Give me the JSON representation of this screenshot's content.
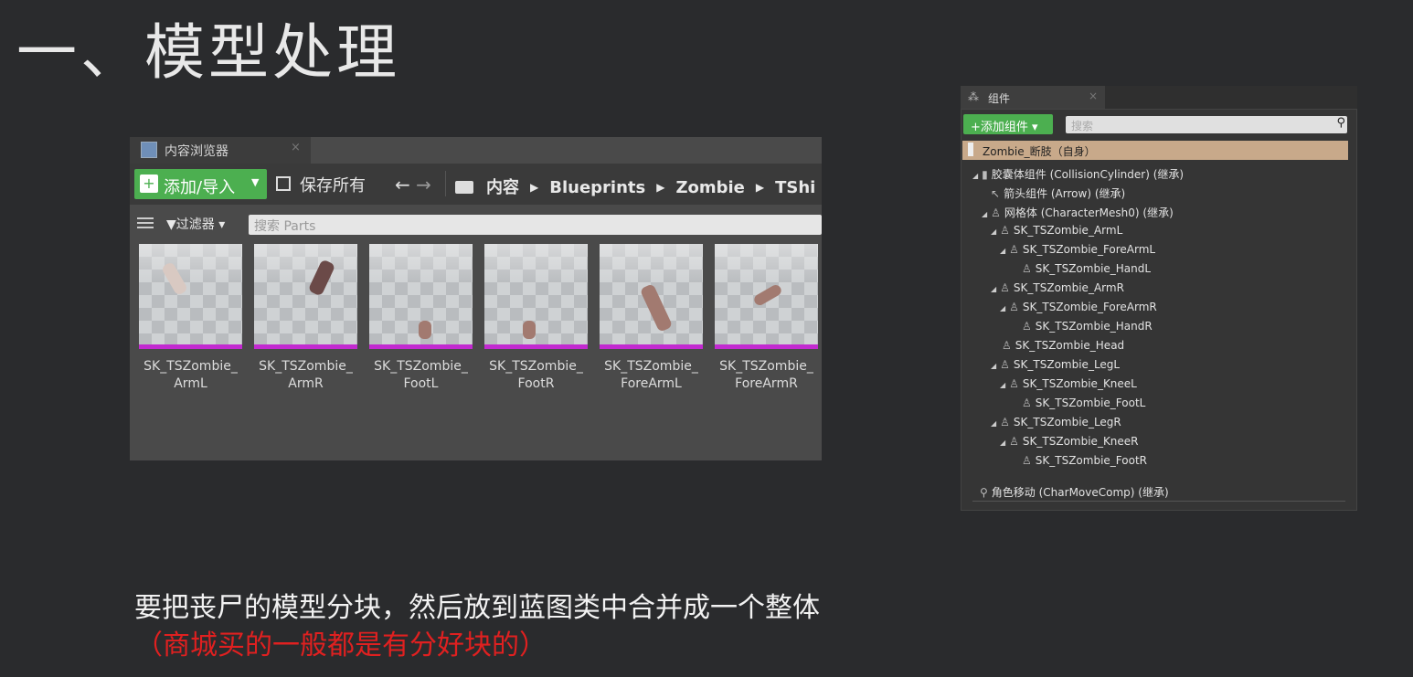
{
  "slide": {
    "title": "一、模型处理",
    "caption_main": "要把丧尸的模型分块，然后放到蓝图类中合并成一个整体",
    "caption_note": "（商城买的一般都是有分好块的）",
    "colors": {
      "note_red": "#e02020",
      "selection_tan": "#c8a98a",
      "add_green": "#4caf50",
      "asset_magenta": "#c22ad0"
    }
  },
  "content_browser": {
    "tab_label": "内容浏览器",
    "close_glyph": "×",
    "add_import_label": "添加/导入",
    "save_all_label": "保存所有",
    "nav_back": "←",
    "nav_forward": "→",
    "breadcrumb": [
      "内容",
      "Blueprints",
      "Zombie",
      "TShi"
    ],
    "filters_label": "▼过滤器",
    "search_placeholder": "搜索 Parts",
    "assets": [
      {
        "line1": "SK_TSZombie_",
        "line2": "ArmL"
      },
      {
        "line1": "SK_TSZombie_",
        "line2": "ArmR"
      },
      {
        "line1": "SK_TSZombie_",
        "line2": "FootL"
      },
      {
        "line1": "SK_TSZombie_",
        "line2": "FootR"
      },
      {
        "line1": "SK_TSZombie_",
        "line2": "ForeArmL"
      },
      {
        "line1": "SK_TSZombie_",
        "line2": "ForeArmR"
      }
    ]
  },
  "components_panel": {
    "tab_label": "组件",
    "close_glyph": "×",
    "add_label": "+添加组件 ▾",
    "search_placeholder": "搜索",
    "self_label": "Zombie_断肢（自身）",
    "tree": [
      "胶囊体组件 (CollisionCylinder) (继承)",
      "箭头组件 (Arrow) (继承)",
      "网格体 (CharacterMesh0) (继承)",
      "SK_TSZombie_ArmL",
      "SK_TSZombie_ForeArmL",
      "SK_TSZombie_HandL",
      "SK_TSZombie_ArmR",
      "SK_TSZombie_ForeArmR",
      "SK_TSZombie_HandR",
      "SK_TSZombie_Head",
      "SK_TSZombie_LegL",
      "SK_TSZombie_KneeL",
      "SK_TSZombie_FootL",
      "SK_TSZombie_LegR",
      "SK_TSZombie_KneeR",
      "SK_TSZombie_FootR"
    ],
    "movement_label": "角色移动 (CharMoveComp) (继承)"
  }
}
